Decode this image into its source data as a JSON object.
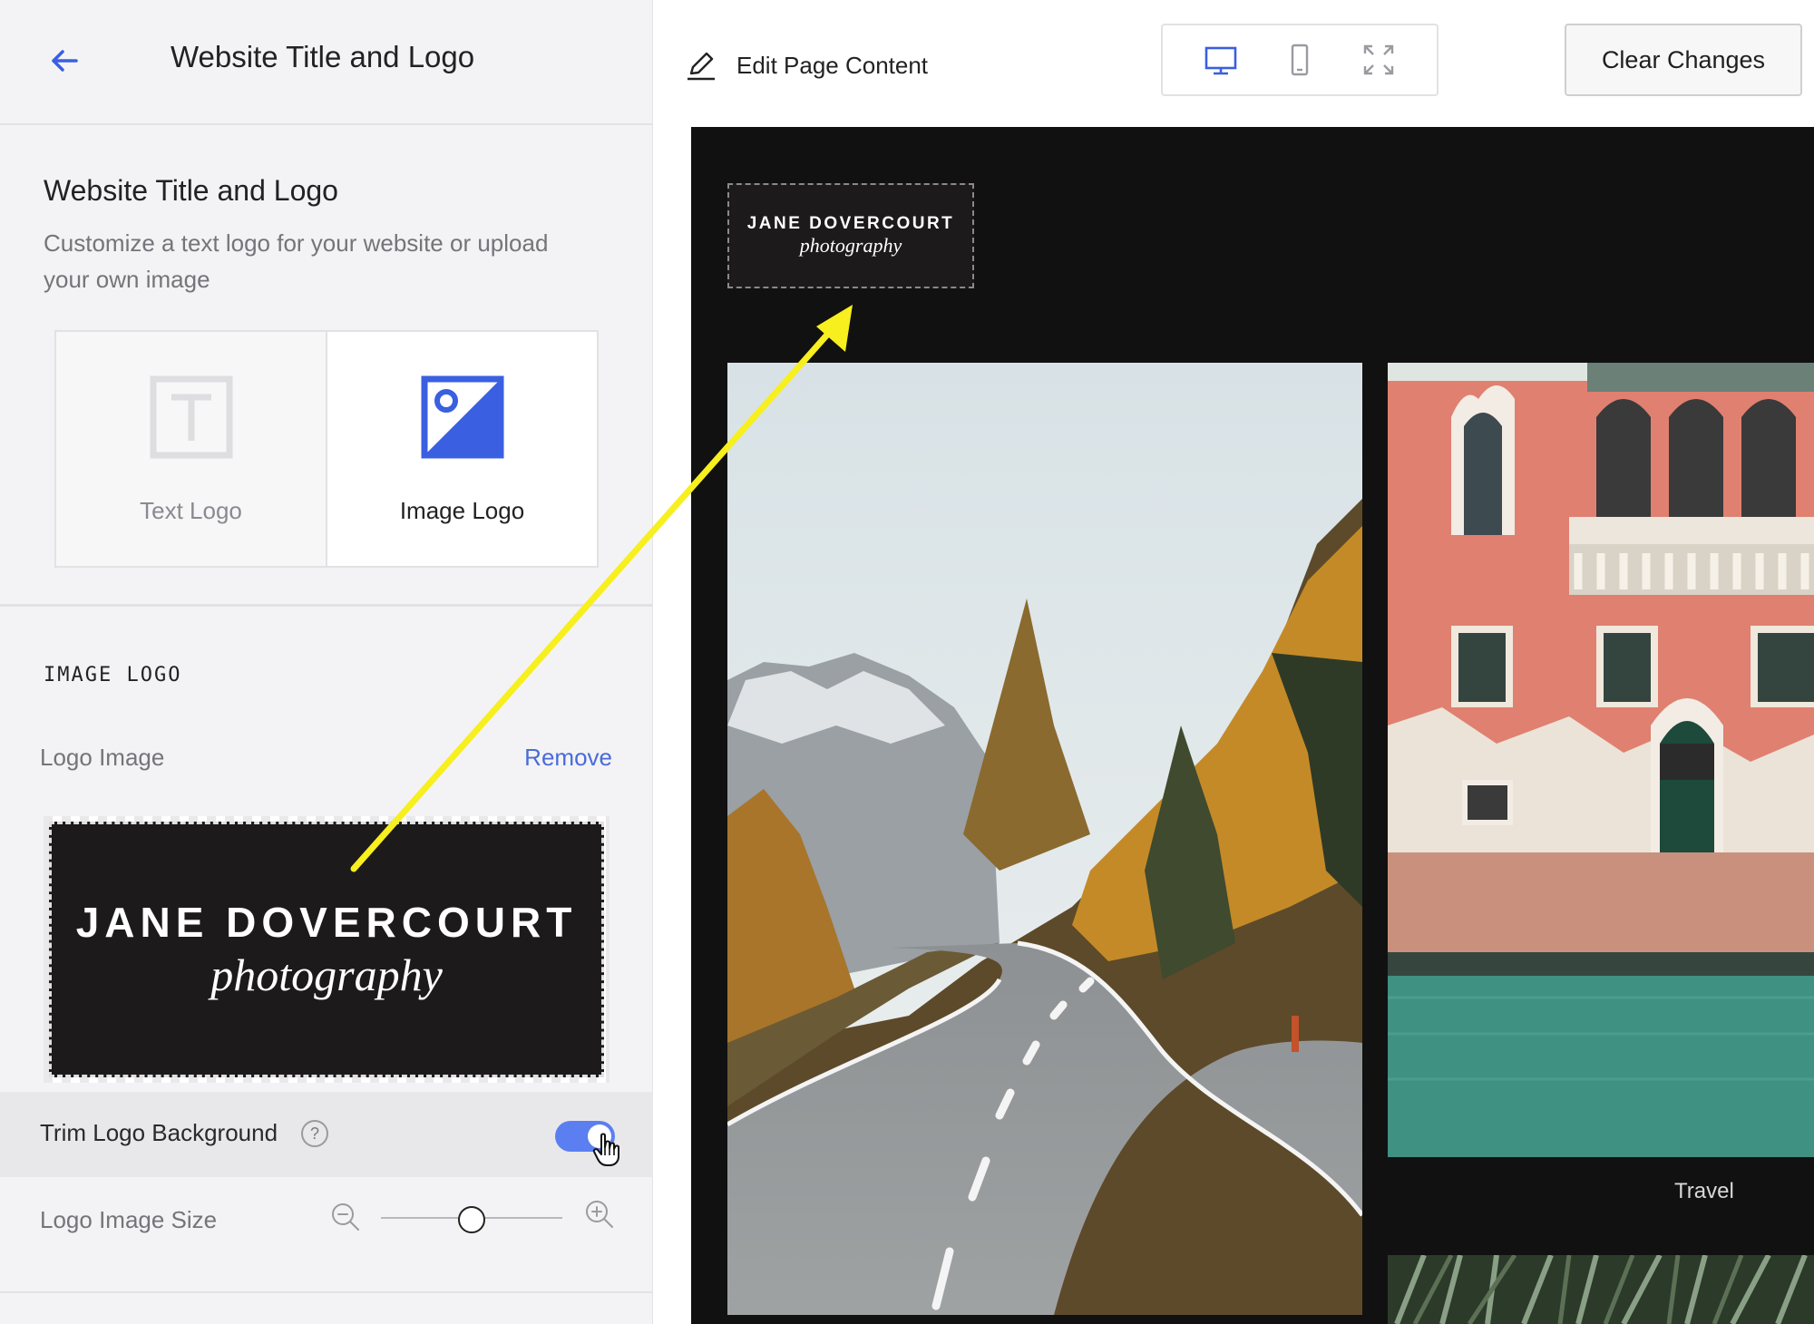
{
  "sidebar": {
    "header_title": "Website Title and Logo",
    "section_title": "Website Title and Logo",
    "section_description": "Customize a text logo for your website or upload your own image",
    "logo_types": [
      {
        "label": "Text Logo",
        "selected": false
      },
      {
        "label": "Image Logo",
        "selected": true
      }
    ],
    "image_logo_heading": "IMAGE LOGO",
    "logo_image_label": "Logo Image",
    "remove_label": "Remove",
    "logo_preview": {
      "name": "JANE DOVERCOURT",
      "subtitle": "photography"
    },
    "trim_label": "Trim Logo Background",
    "trim_help": "?",
    "trim_enabled": true,
    "size_label": "Logo Image Size",
    "size_value": 0.5
  },
  "toolbar": {
    "edit_label": "Edit Page Content",
    "devices": [
      "desktop-icon",
      "mobile-icon",
      "fullscreen-icon"
    ],
    "active_device": "desktop",
    "clear_label": "Clear Changes"
  },
  "preview": {
    "logo_name": "JANE DOVERCOURT",
    "logo_subtitle": "photography",
    "gallery_caption": "Travel"
  },
  "colors": {
    "accent": "#3a5fe0",
    "toggle": "#5b7ff0",
    "link": "#4a6bd8",
    "annotation_arrow": "#f7ef1e",
    "preview_bg": "#111111"
  }
}
